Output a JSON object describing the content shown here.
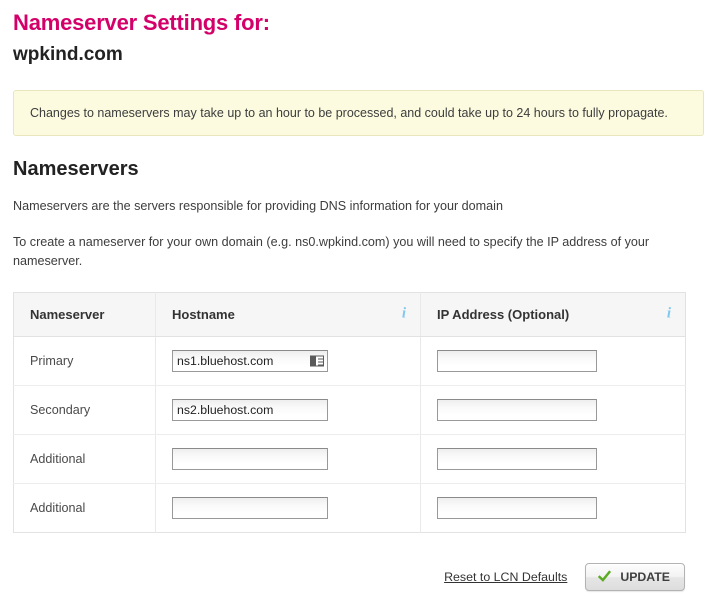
{
  "header": {
    "title": "Nameserver Settings for:",
    "domain": "wpkind.com",
    "title_color": "#d4006a"
  },
  "notice": {
    "text": "Changes to nameservers may take up to an hour to be processed, and could take up to 24 hours to fully propagate.",
    "bg_color": "#fcfbe0",
    "border_color": "#e8e6bd"
  },
  "section": {
    "title": "Nameservers",
    "paragraph_1": "Nameservers are the servers responsible for providing DNS information for your domain",
    "paragraph_2": "To create a nameserver for your own domain (e.g. ns0.wpkind.com) you will need to specify the IP address of your nameserver."
  },
  "table": {
    "columns": [
      {
        "label": "Nameserver",
        "info_icon": false
      },
      {
        "label": "Hostname",
        "info_icon": true,
        "info_icon_name": "info-icon-hostname"
      },
      {
        "label": "IP Address (Optional)",
        "info_icon": true,
        "info_icon_name": "info-icon-ip-address"
      }
    ],
    "info_icon_glyph": "i",
    "info_icon_color": "#7ec8ef",
    "rows": [
      {
        "label": "Primary",
        "hostname": {
          "value": "ns1.bluehost.com",
          "placeholder": "",
          "autofill_icon": "address-book-icon"
        },
        "ip": {
          "value": "",
          "placeholder": ""
        }
      },
      {
        "label": "Secondary",
        "hostname": {
          "value": "ns2.bluehost.com",
          "placeholder": "",
          "autofill_icon": ""
        },
        "ip": {
          "value": "",
          "placeholder": ""
        }
      },
      {
        "label": "Additional",
        "hostname": {
          "value": "",
          "placeholder": "",
          "autofill_icon": ""
        },
        "ip": {
          "value": "",
          "placeholder": ""
        }
      },
      {
        "label": "Additional",
        "hostname": {
          "value": "",
          "placeholder": "",
          "autofill_icon": ""
        },
        "ip": {
          "value": "",
          "placeholder": ""
        }
      }
    ]
  },
  "actions": {
    "reset_label": "Reset to LCN Defaults",
    "update_label": "UPDATE",
    "check_color": "#5bab24"
  }
}
